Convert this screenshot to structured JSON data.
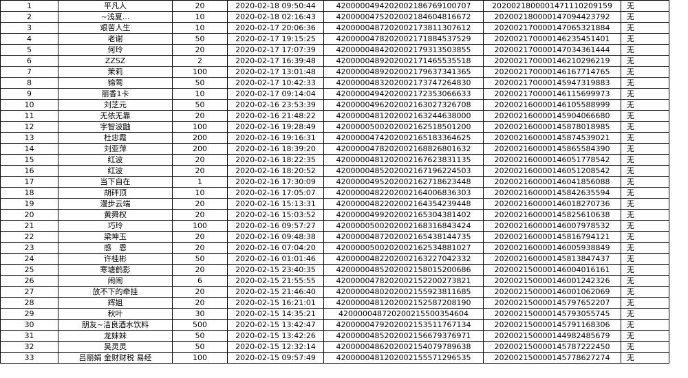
{
  "rows": [
    [
      "1",
      "平凡人",
      "20",
      "2020-02-18 09:50:44",
      "4200000494202002186769100707",
      "2020021800001471110209159",
      "无"
    ],
    [
      "2",
      "~浅夏...",
      "10",
      "2020-02-18 02:16:43",
      "4200000475202002184604816672",
      "2020021800001470944237​92",
      "无"
    ],
    [
      "3",
      "艰苦人生",
      "10",
      "2020-02-17 20:06:36",
      "4200000487202002173811307612",
      "2020021700001470653218​84",
      "无"
    ],
    [
      "4",
      "老谢",
      "50",
      "2020-02-17 19:15:25",
      "4200000478202002171884537529",
      "2020021700001462354514​01",
      "无"
    ],
    [
      "5",
      "何玲",
      "20",
      "2020-02-17 17:07:39",
      "4200000484202002179313503855",
      "2020021700001470343614​44",
      "无"
    ],
    [
      "6",
      "ZZSZ",
      "2",
      "2020-02-17 16:39:48",
      "4200000489202002171465535518",
      "2020021700001462102962​19",
      "无"
    ],
    [
      "7",
      "茉莉",
      "100",
      "2020-02-17 13:01:48",
      "4200000489202002179637341365",
      "2020021700001461677147​65",
      "无"
    ],
    [
      "8",
      "锦莺",
      "50",
      "2020-02-17 10:42:33",
      "4200000483202002173747264830",
      "2020021700001459473198​83",
      "无"
    ],
    [
      "9",
      "丽香1卡",
      "10",
      "2020-02-17 09:14:04",
      "4200000494202002172353066633",
      "2020021700001461156999​73",
      "无"
    ],
    [
      "10",
      "刘芝元",
      "50",
      "2020-02-16 23:53:39",
      "4200000496202002163027326708",
      "2020021600001461055889​99",
      "无"
    ],
    [
      "11",
      "无依无靠",
      "20",
      "2020-02-16 21:48:22",
      "4200000481202002163244638000",
      "2020021600001459040666​80",
      "无"
    ],
    [
      "12",
      "宇智波鼬",
      "100",
      "2020-02-16 19:28:49",
      "4200000500202002162518501200",
      "2020021600001458780189​85",
      "无"
    ],
    [
      "13",
      "杜忠霞",
      "200",
      "2020-02-16 19:16:31",
      "4200000474202002165183364625",
      "2020021600001458745390​21",
      "无"
    ],
    [
      "14",
      "刘亚萍",
      "200",
      "2020-02-16 18:39:20",
      "4200000478202002168826801632",
      "2020021600001458655843​90",
      "无"
    ],
    [
      "15",
      "红波",
      "20",
      "2020-02-16 18:22:35",
      "4200000481202002167623831135",
      "2020021600001460517785​42",
      "无"
    ],
    [
      "16",
      "红波",
      "20",
      "2020-02-16 18:20:52",
      "4200000485202002167196224503",
      "2020021600001460512085​42",
      "无"
    ],
    [
      "17",
      "当下自在",
      "1",
      "2020-02-16 17:30:09",
      "4200000495202002162718623448",
      "2020021600001460418560​88",
      "无"
    ],
    [
      "18",
      "胡砰顶",
      "10",
      "2020-02-16 17:05:07",
      "4200000482202002164006836303",
      "2020021600001458426355​94",
      "无"
    ],
    [
      "19",
      "漫步云端",
      "20",
      "2020-02-16 15:13:31",
      "4200000482202002164354239448",
      "2020021600001460182707​36",
      "无"
    ],
    [
      "20",
      "黄舜权",
      "20",
      "2020-02-16 15:03:52",
      "4200000499202002165304381402",
      "2020021600001458256106​38",
      "无"
    ],
    [
      "21",
      "巧玲",
      "100",
      "2020-02-16 09:57:27",
      "4200000500202002168316843424",
      "2020021600001460079785​32",
      "无"
    ],
    [
      "22",
      "梁坤玉",
      "20",
      "2020-02-16 09:48:38",
      "4200000487202002165438144735",
      "2020021600001458167941​21",
      "无"
    ],
    [
      "23",
      "感　恩",
      "20",
      "2020-02-16 07:04:20",
      "4200000500202002162534881027",
      "2020021600001460059388​49",
      "无"
    ],
    [
      "24",
      "许桂彬",
      "50",
      "2020-02-16 01:01:46",
      "4200000482202002163227042332",
      "2020021600001458138474​37",
      "无"
    ],
    [
      "25",
      "寒塘鹤影",
      "20",
      "2020-02-15 23:40:35",
      "4200000485202002158015200686",
      "2020021500001460040161​61",
      "无"
    ],
    [
      "26",
      "闹闹",
      "6",
      "2020-02-15 21:55:55",
      "4200000478202002152200273821",
      "2020021500001460012423​26",
      "无"
    ],
    [
      "27",
      "放不下的牵挂",
      "20",
      "2020-02-15 21:46:40",
      "4200000480202002155923811685",
      "2020021500001460010620​69",
      "无"
    ],
    [
      "28",
      "辉姐",
      "20",
      "2020-02-15 16:21:01",
      "4200000481202002152587208190",
      "2020021500001457976522​07",
      "无"
    ],
    [
      "29",
      "秋叶",
      "30",
      "2020-02-15 14:35:21",
      "4200000487202002155003546​04",
      "2020021500001457930557​45",
      "无"
    ],
    [
      "30",
      "朋友~洁良酒水饮料",
      "500",
      "2020-02-15 13:42:47",
      "4200000479202002153511767134",
      "2020021500001457911683​06",
      "无"
    ],
    [
      "31",
      "龙妹妹",
      "50",
      "2020-02-15 13:42:26",
      "4200000485202002156679376971",
      "2020021500001449824856​79",
      "无"
    ],
    [
      "32",
      "吴灵灵",
      "50",
      "2020-02-15 12:32:14",
      "4200000486202002154079789638",
      "2020021500001457872224​50",
      "无"
    ],
    [
      "33",
      "吕丽娟 金财财税 易经",
      "100",
      "2020-02-15 09:57:49",
      "4200000481202002155571296535",
      "2020021500001457786272​74",
      "无"
    ]
  ]
}
